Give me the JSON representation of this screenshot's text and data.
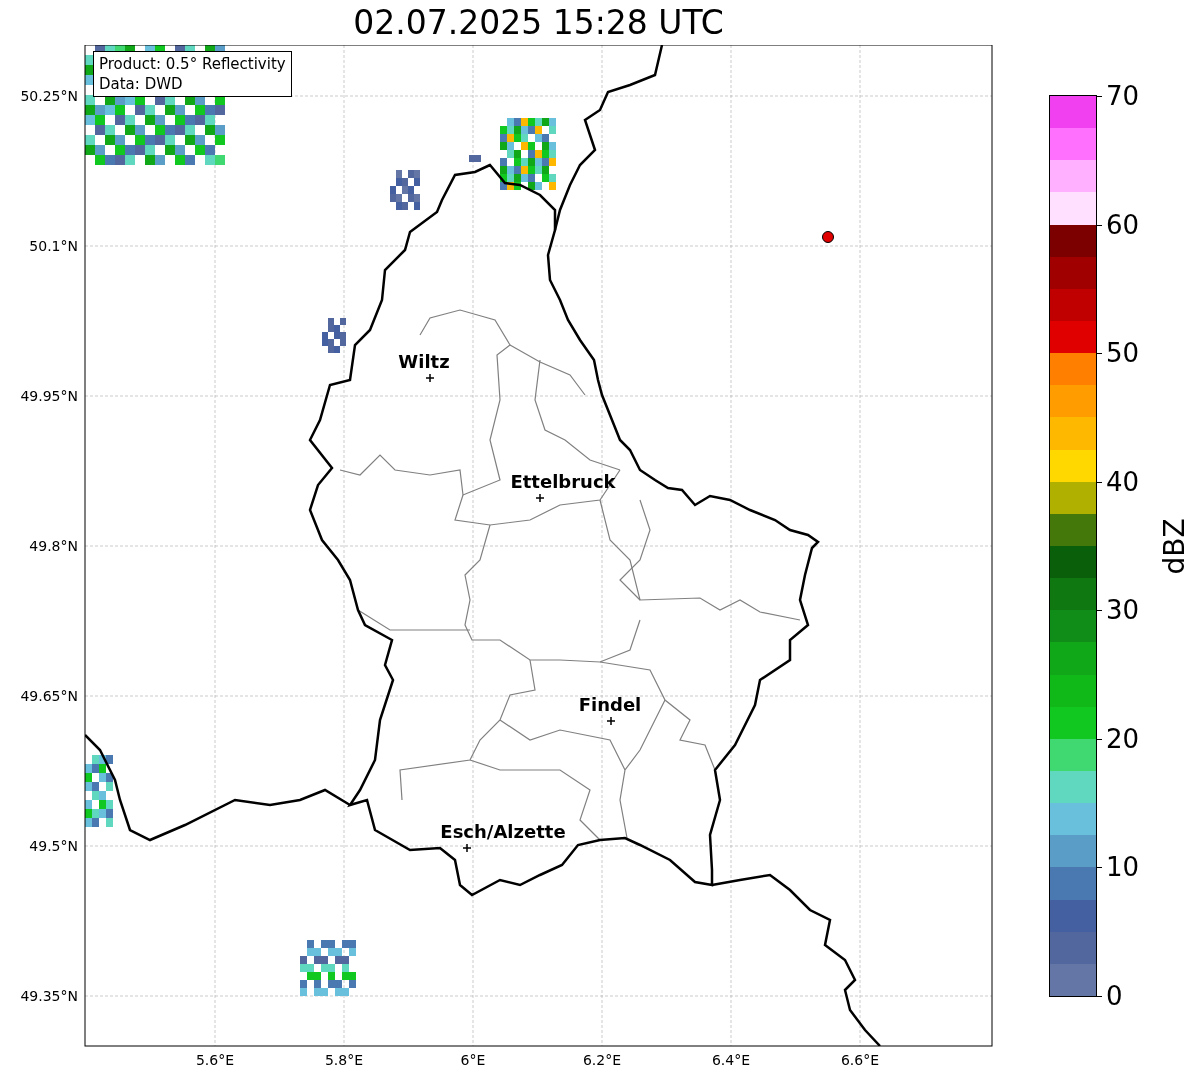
{
  "title": "02.07.2025 15:28 UTC",
  "info": [
    "Product: 0.5° Reflectivity",
    "Data: DWD"
  ],
  "map": {
    "lat_labels": [
      "50.25°N",
      "50.1°N",
      "49.95°N",
      "49.8°N",
      "49.65°N",
      "49.5°N",
      "49.35°N"
    ],
    "lon_labels": [
      "5.6°E",
      "5.8°E",
      "6°E",
      "6.2°E",
      "6.4°E",
      "6.6°E"
    ],
    "cities": [
      {
        "name": "Wiltz"
      },
      {
        "name": "Ettelbruck"
      },
      {
        "name": "Findel"
      },
      {
        "name": "Esch/Alzette"
      }
    ]
  },
  "colorbar": {
    "label": "dBZ",
    "ticks": [
      "70",
      "60",
      "50",
      "40",
      "30",
      "20",
      "10",
      "0"
    ],
    "segments": [
      {
        "color": "#f040f0"
      },
      {
        "color": "#ff70ff"
      },
      {
        "color": "#ffb0ff"
      },
      {
        "color": "#ffe0ff"
      },
      {
        "color": "#7c0000"
      },
      {
        "color": "#a00000"
      },
      {
        "color": "#c00000"
      },
      {
        "color": "#e00000"
      },
      {
        "color": "#ff8000"
      },
      {
        "color": "#ff9c00"
      },
      {
        "color": "#ffb800"
      },
      {
        "color": "#ffd800"
      },
      {
        "color": "#b0b000"
      },
      {
        "color": "#44780a"
      },
      {
        "color": "#0a600a"
      },
      {
        "color": "#107810"
      },
      {
        "color": "#108c18"
      },
      {
        "color": "#10a818"
      },
      {
        "color": "#10b818"
      },
      {
        "color": "#10c820"
      },
      {
        "color": "#40d870"
      },
      {
        "color": "#60d8c0"
      },
      {
        "color": "#68c0dc"
      },
      {
        "color": "#5a9ec8"
      },
      {
        "color": "#4a78b0"
      },
      {
        "color": "#4560a0"
      },
      {
        "color": "#53679f"
      },
      {
        "color": "#6476a6"
      }
    ]
  }
}
